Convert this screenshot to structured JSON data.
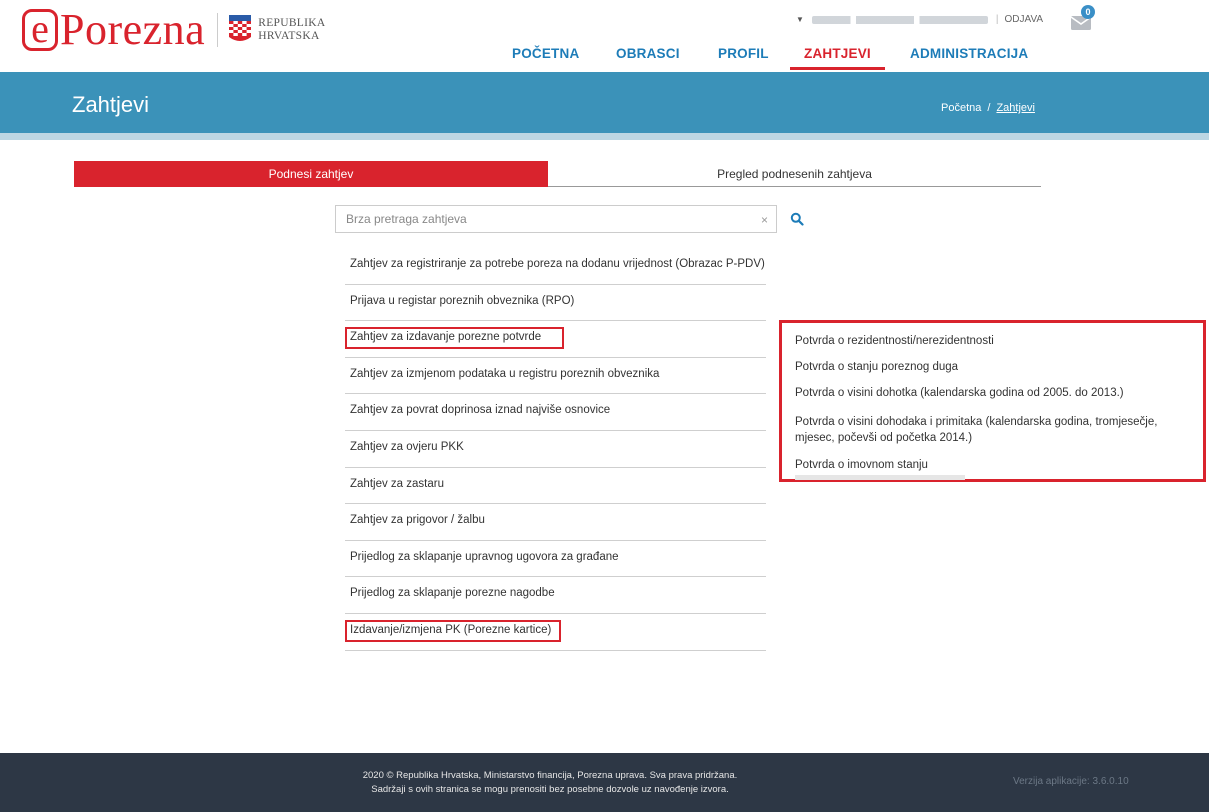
{
  "brand": {
    "logo_letter": "e",
    "logo_text": "Porezna",
    "country_line1": "REPUBLIKA",
    "country_line2": "HRVATSKA"
  },
  "user_bar": {
    "logout": "ODJAVA",
    "separator": "|",
    "mail_count": "0"
  },
  "nav": {
    "items": [
      "POČETNA",
      "OBRASCI",
      "PROFIL",
      "ZAHTJEVI",
      "ADMINISTRACIJA"
    ],
    "active": "ZAHTJEVI"
  },
  "banner": {
    "title": "Zahtjevi",
    "breadcrumb_home": "Početna",
    "breadcrumb_sep": "/",
    "breadcrumb_current": "Zahtjevi"
  },
  "tabs": {
    "submit": "Podnesi zahtjev",
    "review": "Pregled podnesenih zahtjeva"
  },
  "search": {
    "placeholder": "Brza pretraga zahtjeva",
    "clear": "×"
  },
  "requests": [
    "Zahtjev za registriranje za potrebe poreza na dodanu vrijednost (Obrazac P-PDV)",
    "Prijava u registar poreznih obveznika (RPO)",
    "Zahtjev za izdavanje porezne potvrde",
    "Zahtjev za izmjenom podataka u registru poreznih obveznika",
    "Zahtjev za povrat doprinosa iznad najviše osnovice",
    "Zahtjev za ovjeru PKK",
    "Zahtjev za zastaru",
    "Zahtjev za prigovor / žalbu",
    "Prijedlog za sklapanje upravnog ugovora za građane",
    "Prijedlog za sklapanje porezne nagodbe",
    "Izdavanje/izmjena PK (Porezne kartice)"
  ],
  "certificate_options": [
    "Potvrda o rezidentnosti/nerezidentnosti",
    "Potvrda o stanju poreznog duga",
    "Potvrda o visini dohotka (kalendarska godina od 2005. do 2013.)",
    "Potvrda o visini dohodaka i primitaka (kalendarska godina, tromjesečje, mjesec, počevši od početka 2014.)",
    "Potvrda o imovnom stanju"
  ],
  "footer": {
    "line1": "2020 © Republika Hrvatska, Ministarstvo financija, Porezna uprava. Sva prava pridržana.",
    "line2": "Sadržaji s ovih stranica se mogu prenositi bez posebne dozvole uz navođenje izvora.",
    "version": "Verzija aplikacije: 3.6.0.10"
  },
  "colors": {
    "brand_red": "#d9232d",
    "nav_blue": "#1d7cb8",
    "banner_blue": "#3b92b9",
    "footer_dark": "#2d3745"
  }
}
